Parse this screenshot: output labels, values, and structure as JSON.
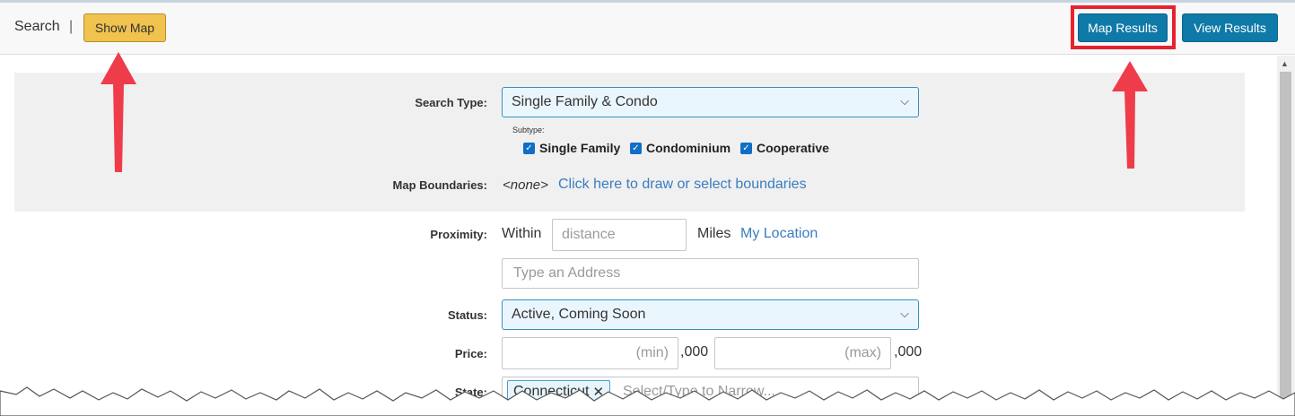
{
  "header": {
    "search_label": "Search",
    "separator": "|",
    "show_map_label": "Show Map",
    "map_results_label": "Map Results",
    "view_results_label": "View Results"
  },
  "form": {
    "search_type": {
      "label": "Search Type:",
      "value": "Single Family & Condo"
    },
    "subtype": {
      "caption": "Subtype:",
      "options": [
        {
          "label": "Single Family",
          "checked": true
        },
        {
          "label": "Condominium",
          "checked": true
        },
        {
          "label": "Cooperative",
          "checked": true
        }
      ]
    },
    "map_boundaries": {
      "label": "Map Boundaries:",
      "value": "<none>",
      "link": "Click here to draw or select boundaries"
    },
    "proximity": {
      "label": "Proximity:",
      "within": "Within",
      "distance_placeholder": "distance",
      "miles": "Miles",
      "my_location": "My Location",
      "address_placeholder": "Type an Address"
    },
    "status": {
      "label": "Status:",
      "value": "Active, Coming Soon"
    },
    "price": {
      "label": "Price:",
      "min_placeholder": "(min)",
      "max_placeholder": "(max)",
      "suffix": ",000"
    },
    "state": {
      "label": "State:",
      "tag": "Connecticut",
      "tag_remove": "✕",
      "placeholder": "Select/Type to Narrow..."
    }
  },
  "icons": {
    "dropdown": "chevron-down-icon",
    "tag_remove": "close-icon",
    "scroll_up": "scroll-up-arrow-icon"
  },
  "colors": {
    "show_map_button": "#f0c24e",
    "primary_button": "#0f79a8",
    "highlight": "#e8212e",
    "link": "#3a7cc1",
    "panel": "#f0f0f0",
    "select_background": "#eaf6fd"
  }
}
